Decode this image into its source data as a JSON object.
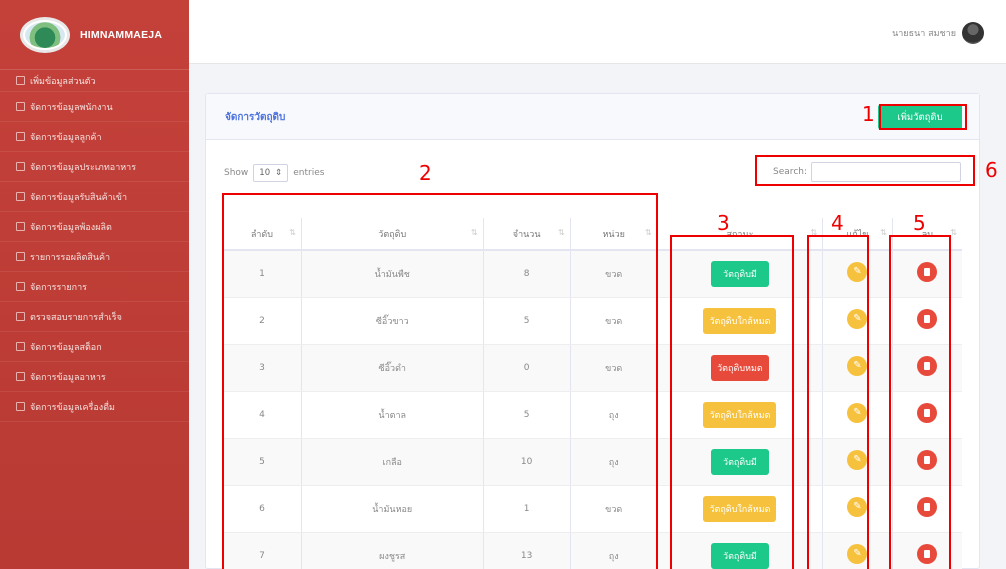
{
  "app": {
    "brand": "HIMNAMMAEJA"
  },
  "sidebar": {
    "items": [
      {
        "label": "เพิ่มข้อมูลส่วนตัว"
      },
      {
        "label": "จัดการข้อมูลพนักงาน"
      },
      {
        "label": "จัดการข้อมูลลูกค้า"
      },
      {
        "label": "จัดการข้อมูลประเภทอาหาร"
      },
      {
        "label": "จัดการข้อมูลรับสินค้าเข้า"
      },
      {
        "label": "จัดการข้อมูลพ้องผลิต"
      },
      {
        "label": "รายการรอผลิตสินค้า"
      },
      {
        "label": "จัดการรายการ"
      },
      {
        "label": "ตรวจสอบรายการสำเร็จ"
      },
      {
        "label": "จัดการข้อมูลสต็อก"
      },
      {
        "label": "จัดการข้อมูลอาหาร"
      },
      {
        "label": "จัดการข้อมูลเครื่องดื่ม"
      }
    ]
  },
  "topbar": {
    "user_name": "นายธนา สมชาย"
  },
  "card": {
    "title": "จัดการวัตถุดิบ",
    "add_button": "เพิ่มวัตถุดิบ",
    "show_label": "Show",
    "entries_value": "10",
    "entries_label": "entries",
    "search_label": "Search:"
  },
  "table": {
    "headers": [
      "ลำดับ",
      "วัตถุดิบ",
      "จำนวน",
      "หน่วย",
      "สถานะ",
      "แก้ไข",
      "ลบ"
    ],
    "rows": [
      {
        "no": "1",
        "name": "น้ำมันพืช",
        "qty": "8",
        "unit": "ขวด",
        "status": "วัตถุดิบมี",
        "status_type": "green"
      },
      {
        "no": "2",
        "name": "ซีอิ๊วขาว",
        "qty": "5",
        "unit": "ขวด",
        "status": "วัตถุดิบใกล้หมด",
        "status_type": "yellow"
      },
      {
        "no": "3",
        "name": "ซีอิ๊วดำ",
        "qty": "0",
        "unit": "ขวด",
        "status": "วัตถุดิบหมด",
        "status_type": "red"
      },
      {
        "no": "4",
        "name": "น้ำตาล",
        "qty": "5",
        "unit": "ถุง",
        "status": "วัตถุดิบใกล้หมด",
        "status_type": "yellow"
      },
      {
        "no": "5",
        "name": "เกลือ",
        "qty": "10",
        "unit": "ถุง",
        "status": "วัตถุดิบมี",
        "status_type": "green"
      },
      {
        "no": "6",
        "name": "น้ำมันหอย",
        "qty": "1",
        "unit": "ขวด",
        "status": "วัตถุดิบใกล้หมด",
        "status_type": "yellow"
      },
      {
        "no": "7",
        "name": "ผงชูรส",
        "qty": "13",
        "unit": "ถุง",
        "status": "วัตถุดิบมี",
        "status_type": "green"
      }
    ]
  },
  "annotations": [
    "1",
    "2",
    "3",
    "4",
    "5",
    "6"
  ],
  "colors": {
    "sidebar": "#c0392b",
    "accent": "#4e73df",
    "success": "#1cc88a",
    "warning": "#f6c23e",
    "danger": "#e74a3b",
    "annotation": "#e00000"
  }
}
